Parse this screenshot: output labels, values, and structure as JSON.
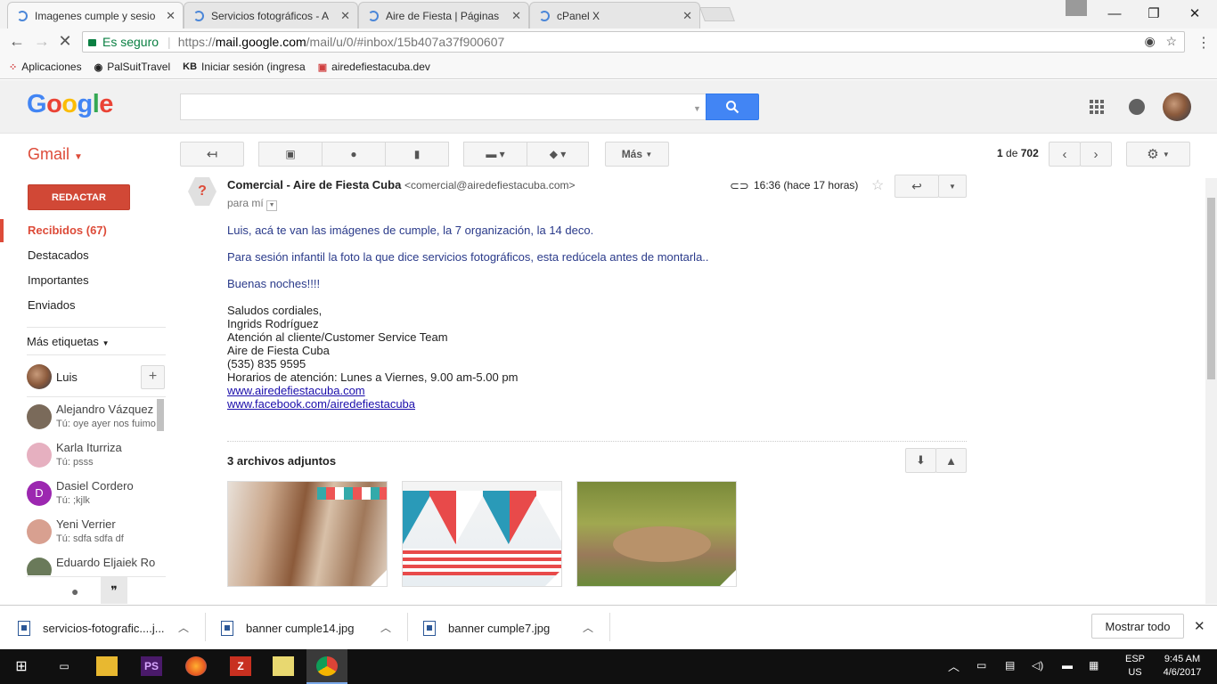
{
  "browser": {
    "tabs": [
      {
        "title": "Imagenes cumple y sesio",
        "active": true
      },
      {
        "title": "Servicios fotográficos - A",
        "active": false
      },
      {
        "title": "Aire de Fiesta | Páginas",
        "active": false
      },
      {
        "title": "cPanel X",
        "active": false
      }
    ],
    "secure_label": "Es seguro",
    "url_scheme": "https://",
    "url_host": "mail.google.com",
    "url_path": "/mail/u/0/#inbox/15b407a37f900607",
    "bookmarks": [
      "Aplicaciones",
      "PalSuitTravel",
      "Iniciar sesión (ingresa",
      "airedefiestacuba.dev"
    ],
    "bookmark_icons": [
      "apps-grid",
      "globe",
      "KB",
      "site"
    ]
  },
  "google": {
    "logo": "Google",
    "search_value": ""
  },
  "gmail": {
    "label": "Gmail",
    "toolbar": {
      "more": "Más"
    },
    "pager": {
      "current": "1",
      "of": "de",
      "total": "702"
    },
    "compose": "REDACTAR",
    "nav": [
      "Recibidos (67)",
      "Destacados",
      "Importantes",
      "Enviados"
    ],
    "more_labels": "Más etiquetas",
    "chat_user": "Luis",
    "contacts": [
      {
        "name": "Alejandro Vázquez",
        "last": "Tú: oye ayer nos fuimo",
        "color": "#7a6a5a"
      },
      {
        "name": "Karla Iturriza",
        "last": "Tú: psss",
        "color": "#e6b0c0"
      },
      {
        "name": "Dasiel Cordero",
        "last": "Tú: ;kjlk",
        "color": "#9c27b0",
        "initial": "D"
      },
      {
        "name": "Yeni Verrier",
        "last": "Tú: sdfa sdfa df",
        "color": "#d8a090"
      },
      {
        "name": "Eduardo Eljaiek Ro",
        "last": "",
        "color": "#6a7a5a"
      }
    ]
  },
  "message": {
    "sender_name": "Comercial - Aire de Fiesta Cuba",
    "sender_email": "<comercial@airedefiestacuba.com>",
    "to": "para mí",
    "time": "16:36 (hace 17 horas)",
    "body": [
      "Luis, acá te van las imágenes de cumple, la 7 organización, la 14 deco.",
      "Para sesión infantil la foto la que dice servicios fotográficos, esta redúcela antes de montarla..",
      "Buenas noches!!!!"
    ],
    "signature": [
      "Saludos cordiales,",
      "Ingrids Rodríguez",
      "Atención al cliente/Customer Service Team",
      "Aire de Fiesta Cuba",
      "(535) 835 9595",
      "Horarios de atención: Lunes a Viernes, 9.00 am-5.00 pm"
    ],
    "links": [
      "www.airedefiestacuba.com",
      "www.facebook.com/airedefiestacuba"
    ],
    "attachments_title": "3 archivos adjuntos"
  },
  "downloads": {
    "items": [
      "servicios-fotografic....j...",
      "banner cumple14.jpg",
      "banner cumple7.jpg"
    ],
    "show_all": "Mostrar todo"
  },
  "taskbar": {
    "lang": "ESP",
    "layout": "US",
    "time": "9:45 AM",
    "date": "4/6/2017"
  }
}
